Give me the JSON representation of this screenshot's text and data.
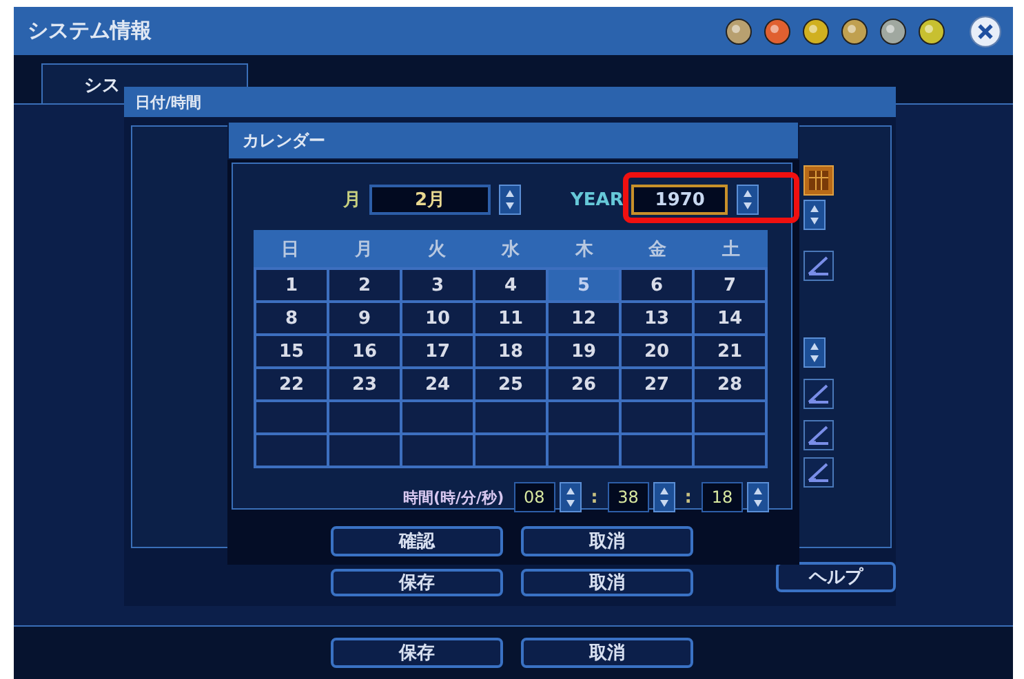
{
  "window": {
    "title": "システム情報"
  },
  "tabs": [
    {
      "label": "シス",
      "selected": true
    }
  ],
  "datetime_dialog": {
    "title": "日付/時間",
    "buttons": [
      "保存",
      "取消",
      "ヘルプ"
    ]
  },
  "calendar_dialog": {
    "title": "カレンダー",
    "month_label": "月",
    "month": "2月",
    "year_label": "YEAR",
    "year": "1970",
    "year_highlighted": true,
    "weekdays": [
      "日",
      "月",
      "火",
      "水",
      "木",
      "金",
      "土"
    ],
    "days": [
      {
        "label": "1",
        "selected": false
      },
      {
        "label": "2",
        "selected": false
      },
      {
        "label": "3",
        "selected": false
      },
      {
        "label": "4",
        "selected": false
      },
      {
        "label": "5",
        "selected": true
      },
      {
        "label": "6",
        "selected": false
      },
      {
        "label": "7",
        "selected": false
      },
      {
        "label": "8",
        "selected": false
      },
      {
        "label": "9",
        "selected": false
      },
      {
        "label": "10",
        "selected": false
      },
      {
        "label": "11",
        "selected": false
      },
      {
        "label": "12",
        "selected": false
      },
      {
        "label": "13",
        "selected": false
      },
      {
        "label": "14",
        "selected": false
      },
      {
        "label": "15",
        "selected": false
      },
      {
        "label": "16",
        "selected": false
      },
      {
        "label": "17",
        "selected": false
      },
      {
        "label": "18",
        "selected": false
      },
      {
        "label": "19",
        "selected": false
      },
      {
        "label": "20",
        "selected": false
      },
      {
        "label": "21",
        "selected": false
      },
      {
        "label": "22",
        "selected": false
      },
      {
        "label": "23",
        "selected": false
      },
      {
        "label": "24",
        "selected": false
      },
      {
        "label": "25",
        "selected": false
      },
      {
        "label": "26",
        "selected": false
      },
      {
        "label": "27",
        "selected": false
      },
      {
        "label": "28",
        "selected": false
      }
    ],
    "time_label": "時間(時/分/秒)",
    "hour": "08",
    "minute": "38",
    "second": "18",
    "separators": [
      ":",
      ":"
    ],
    "buttons": [
      "確認",
      "取消"
    ]
  },
  "footer_buttons": [
    "保存",
    "取消"
  ]
}
